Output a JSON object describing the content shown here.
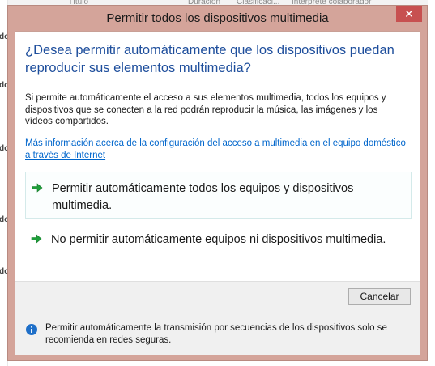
{
  "background_app": {
    "columns": [
      "Título",
      "Duración",
      "Clasificaci...",
      "Intérprete colaborador"
    ],
    "left_labels": [
      "do",
      "do",
      "do",
      "do",
      "do"
    ]
  },
  "dialog": {
    "title": "Permitir todos los dispositivos multimedia",
    "close_symbol": "✕",
    "heading": "¿Desea permitir automáticamente que los dispositivos puedan reproducir sus elementos multimedia?",
    "description": "Si permite automáticamente el acceso a sus elementos multimedia, todos los equipos y dispositivos que se conecten a la red podrán reproducir la música, las imágenes y los vídeos compartidos.",
    "link": "Más información acerca de la configuración del acceso a multimedia en el equipo doméstico a través de Internet",
    "options": [
      {
        "label": "Permitir automáticamente todos los equipos y dispositivos multimedia.",
        "icon": "green-arrow-icon"
      },
      {
        "label": "No permitir automáticamente equipos ni dispositivos multimedia.",
        "icon": "green-arrow-icon"
      }
    ],
    "cancel_label": "Cancelar",
    "footer_note": "Permitir automáticamente la transmisión por secuencias de los dispositivos solo se recomienda en redes seguras.",
    "colors": {
      "frame": "#d4a49a",
      "heading": "#1e4e9c",
      "link": "#0066cc",
      "close": "#c75050",
      "arrow": "#1e9e3a",
      "info": "#1e6fc8"
    }
  }
}
